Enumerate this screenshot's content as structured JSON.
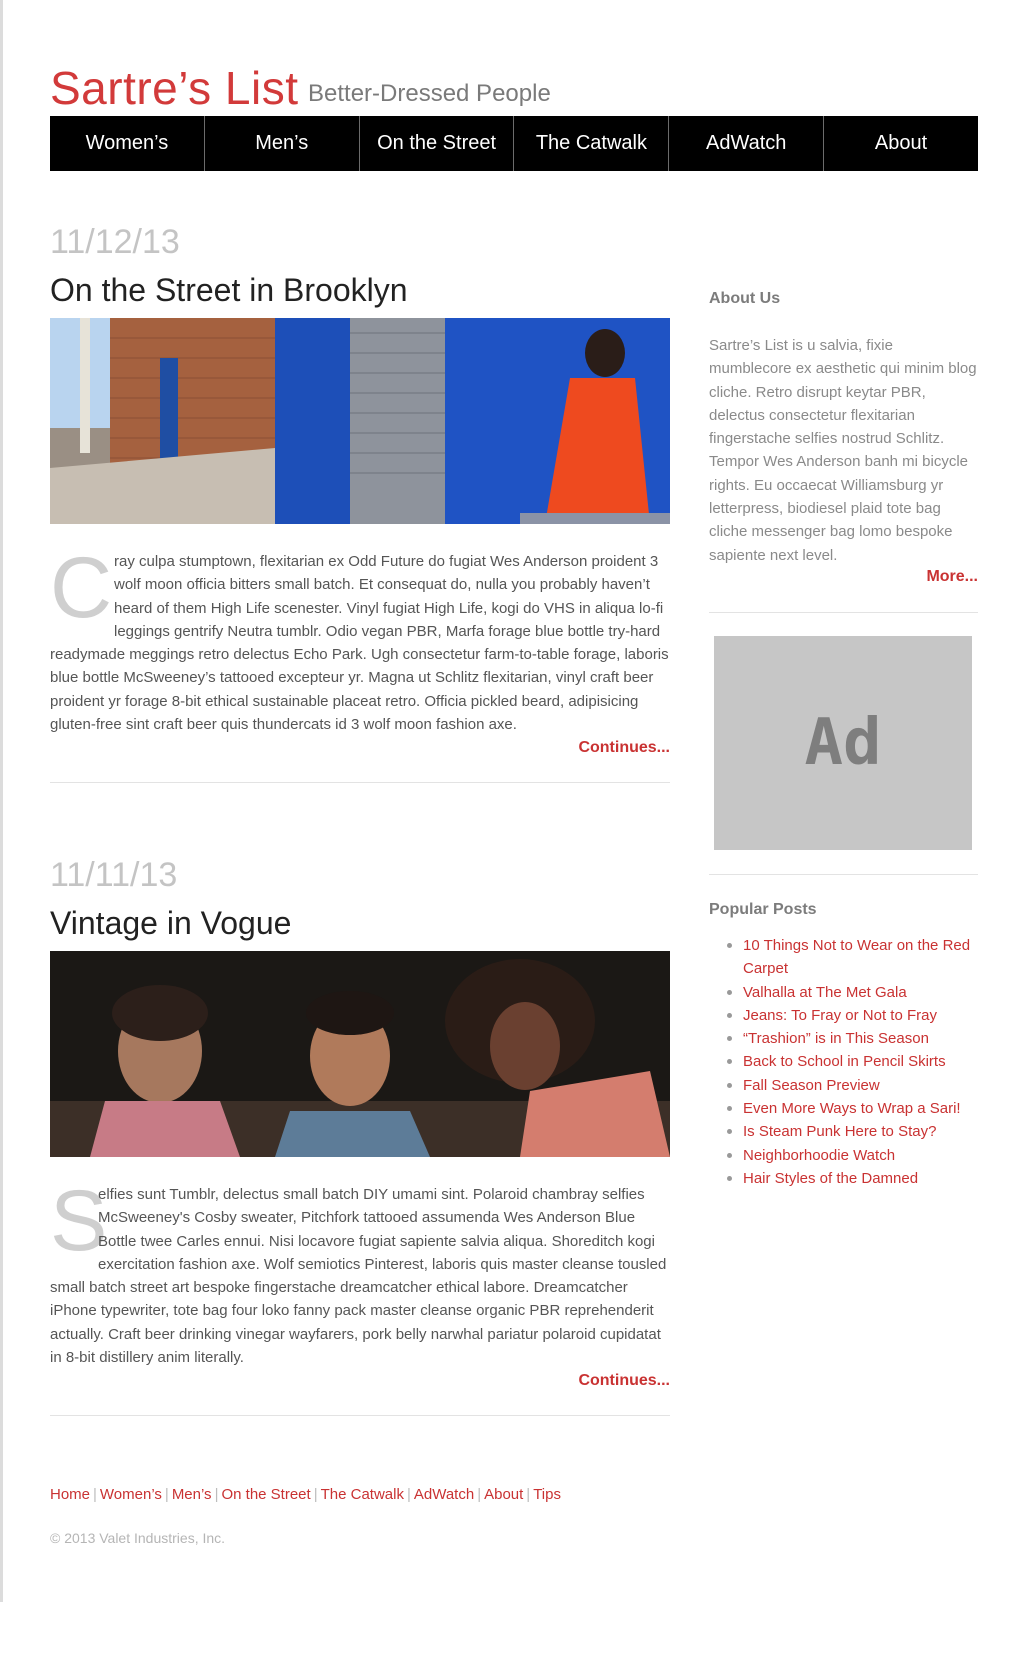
{
  "site": {
    "title": "Sartre’s List",
    "tagline": "Better-Dressed People"
  },
  "nav": {
    "items": [
      "Women’s",
      "Men’s",
      "On the Street",
      "The Catwalk",
      "AdWatch",
      "About"
    ]
  },
  "posts": [
    {
      "date": "11/12/13",
      "title": "On the Street in Brooklyn",
      "dropcap": "C",
      "body": "ray culpa stumptown, flexitarian ex Odd Future do fugiat Wes Anderson proident 3 wolf moon officia bitters small batch. Et consequat do, nulla you probably haven’t heard of them High Life scenester. Vinyl fugiat High Life, kogi do VHS in aliqua lo-fi leggings gentrify Neutra tumblr. Odio vegan PBR, Marfa forage blue bottle try-hard readymade meggings retro delectus Echo Park. Ugh consectetur farm-to-table forage, laboris blue bottle McSweeney’s tattooed excepteur yr. Magna ut Schlitz flexitarian, vinyl craft beer proident yr forage 8-bit ethical sustainable placeat retro. Officia pickled beard, adipisicing gluten-free sint craft beer quis thundercats id 3 wolf moon fashion axe.",
      "continue": "Continues..."
    },
    {
      "date": "11/11/13",
      "title": "Vintage in Vogue",
      "dropcap": "S",
      "body": "elfies sunt Tumblr, delectus small batch DIY umami sint. Polaroid chambray selfies McSweeney's Cosby sweater, Pitchfork tattooed assumenda Wes Anderson Blue Bottle twee Carles ennui. Nisi locavore fugiat sapiente salvia aliqua. Shoreditch kogi exercitation fashion axe. Wolf semiotics Pinterest, laboris quis master cleanse tousled small batch street art bespoke fingerstache dreamcatcher ethical labore. Dreamcatcher iPhone typewriter, tote bag four loko fanny pack master cleanse organic PBR reprehenderit actually. Craft beer drinking vinegar wayfarers, pork belly narwhal pariatur polaroid cupidatat in 8-bit distillery anim literally.",
      "continue": "Continues..."
    }
  ],
  "sidebar": {
    "about_heading": "About Us",
    "about_text": "Sartre’s List is u salvia, fixie mumblecore ex aesthetic qui minim blog cliche. Retro disrupt keytar PBR, delectus consectetur flexitarian fingerstache selfies nostrud Schlitz. Tempor Wes Anderson banh mi bicycle rights. Eu occaecat Williamsburg yr letterpress, biodiesel plaid tote bag cliche messenger bag lomo bespoke sapiente next level.",
    "more_link": "More...",
    "ad_label": "Ad",
    "popular_heading": "Popular Posts",
    "popular_posts": [
      "10 Things Not to Wear on the Red Carpet",
      "Valhalla at The Met Gala",
      "Jeans: To Fray or Not to Fray",
      "“Trashion” is in This Season",
      "Back to School in Pencil Skirts",
      "Fall Season Preview",
      "Even More Ways to Wrap a Sari!",
      "Is Steam Punk Here to Stay?",
      "Neighborhoodie Watch",
      "Hair Styles of the Damned"
    ]
  },
  "footer": {
    "links": [
      "Home",
      "Women’s",
      "Men’s",
      "On the Street",
      "The Catwalk",
      "AdWatch",
      "About",
      "Tips"
    ],
    "copyright": "© 2013 Valet Industries, Inc."
  },
  "colors": {
    "accent": "#d23a3a",
    "nav_background": "#000000",
    "ad_background": "#c6c6c6"
  }
}
